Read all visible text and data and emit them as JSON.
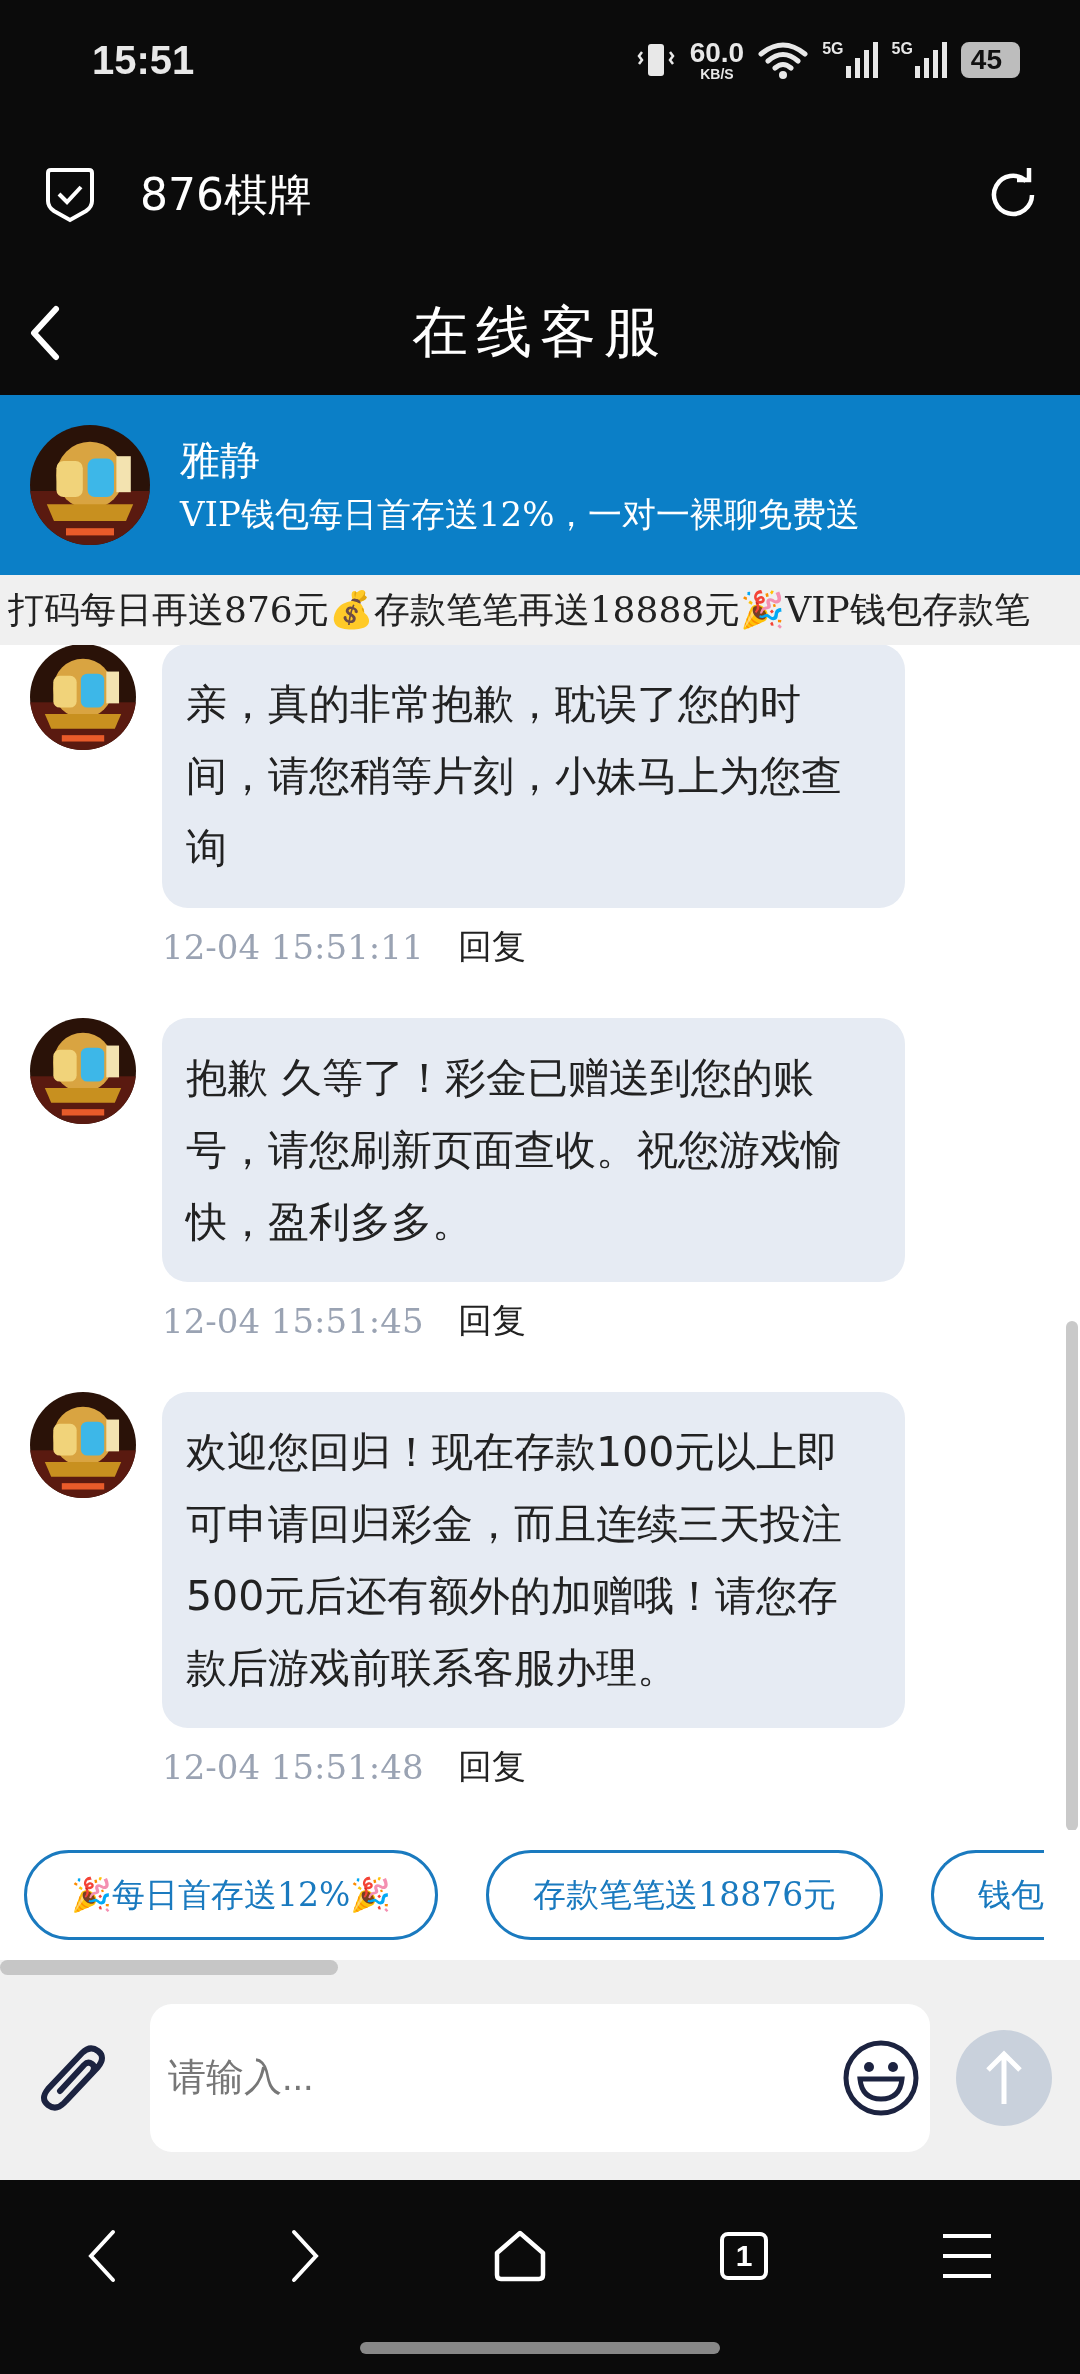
{
  "status_bar": {
    "time": "15:51",
    "speed": "60.0",
    "speed_unit": "KB/S",
    "networks": [
      "5G",
      "5G"
    ],
    "battery": "45"
  },
  "browser_bar": {
    "title": "876棋牌"
  },
  "title_bar": {
    "title": "在线客服"
  },
  "agent": {
    "name": "雅静",
    "tagline": "VIP钱包每日首存送12%，一对一裸聊免费送"
  },
  "marquee": "打码每日再送876元💰存款笔笔再送18888元🎉VIP钱包存款笔",
  "messages": [
    {
      "text": "亲，真的非常抱歉，耽误了您的时间，请您稍等片刻，小妹马上为您查询",
      "time": "12-04 15:51:11",
      "reply": "回复"
    },
    {
      "text": "抱歉 久等了！彩金已赠送到您的账号，请您刷新页面查收。祝您游戏愉快，盈利多多。",
      "time": "12-04 15:51:45",
      "reply": "回复"
    },
    {
      "text": "欢迎您回归！现在存款100元以上即可申请回归彩金，而且连续三天投注500元后还有额外的加赠哦！请您存款后游戏前联系客服办理。",
      "time": "12-04 15:51:48",
      "reply": "回复"
    }
  ],
  "quick_replies": [
    "🎉每日首存送12%🎉",
    "存款笔笔送18876元",
    "钱包"
  ],
  "input": {
    "placeholder": "请输入..."
  },
  "send_button": {
    "disabled": true
  },
  "nav_bar": {
    "tab_count": "1"
  }
}
